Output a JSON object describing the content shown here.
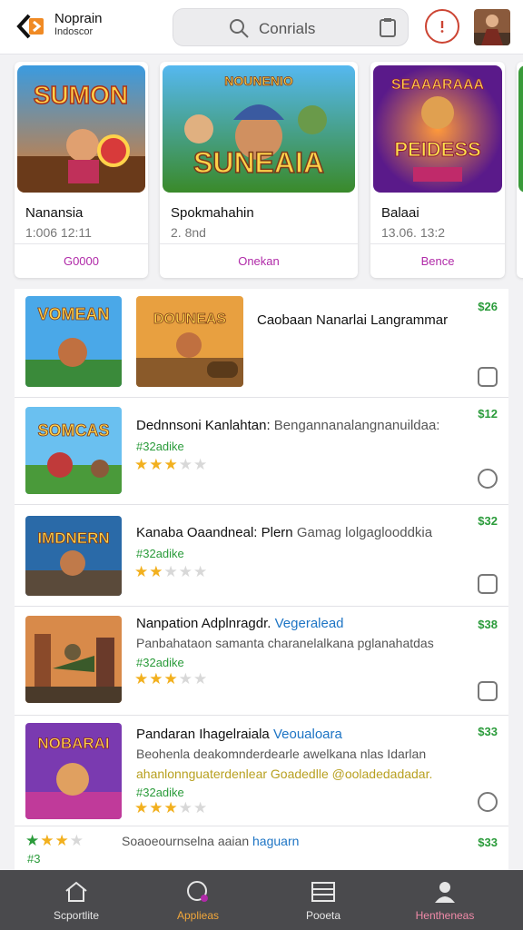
{
  "header": {
    "brand_line1": "Noprain",
    "brand_line2": "Indoscor",
    "search_placeholder": "Conrials"
  },
  "featured": [
    {
      "art_text": "SUMON",
      "title": "Nanansia",
      "meta": "1:006   12:11",
      "button": "G0000"
    },
    {
      "art_text": "SUNEAIA",
      "art_sub": "NOUNENIO",
      "title": "Spokmahahin",
      "meta": "2. 8nd",
      "button": "Onekan"
    },
    {
      "art_text": "SEAAARAAA",
      "art_sub": "PEIDESS",
      "title": "Balaai",
      "meta": "13.06.   13:2",
      "button": "Bence"
    }
  ],
  "list": [
    {
      "thumb_text": "VOMEAN",
      "thumb2_text": "DOUNEAS",
      "title": "Caobaan Nanarlai Langrammar",
      "price": "$26"
    },
    {
      "thumb_text": "SOMCAS",
      "title": "Dednnsoni Kanlahtan:",
      "desc": "Bengannanalangnanuildaa:",
      "sub": "#32adike",
      "rating": 3,
      "price": "$12"
    },
    {
      "thumb_text": "IMDNERN",
      "title": "Kanaba Oaandneal: Plern",
      "desc": "Gamag lolgaglooddkia",
      "sub": "#32adike",
      "rating": 2,
      "price": "$32"
    },
    {
      "title": "Nanpation Adplnragdr.",
      "tag": "Vegeralead",
      "line2": "Panbahataon samanta charanelalkana pglanahatdas",
      "sub": "#32adike",
      "rating": 3,
      "price": "$38"
    },
    {
      "thumb_text": "NOBARAI",
      "title": "Pandaran Ihagelraiala",
      "tag": "Veoualoara",
      "line2": "Beohenla deakomnderdearle awelkana nlas Idarlan",
      "line3": "ahanlonnguaterdenlear Goadedlle @ooladedadadar.",
      "sub": "#32adike",
      "rating": 3,
      "price": "$33"
    },
    {
      "title": "Soaoeournselna aaian",
      "tag": "haguarn",
      "sub": "#3",
      "price": "$33"
    }
  ],
  "nav": [
    {
      "label": "Scportlite",
      "color": "#e6e6e6"
    },
    {
      "label": "Applieas",
      "color": "#f2a73a"
    },
    {
      "label": "Pooeta",
      "color": "#e6e6e6"
    },
    {
      "label": "Hentheneas",
      "color": "#f08aa8"
    }
  ],
  "colors": {
    "accent_purple": "#b02aa8",
    "price_green": "#2a9b3a",
    "star": "#f2b01e",
    "nav_bg": "#4a4a4d"
  }
}
